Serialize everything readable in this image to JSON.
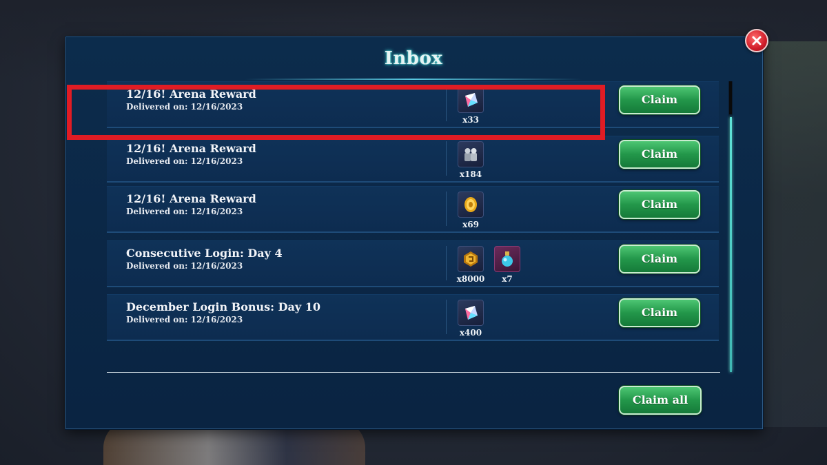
{
  "window": {
    "title": "Inbox"
  },
  "colors": {
    "accent": "#3fd3d0",
    "claim_button": "#23974a",
    "highlight": "#e01c24",
    "close_button": "#d11e2a"
  },
  "close_icon": "close-icon",
  "mails": [
    {
      "title": "12/16! Arena Reward",
      "date": "Delivered on: 12/16/2023",
      "rewards": [
        {
          "icon": "crystal-icon",
          "count": "x33"
        }
      ],
      "claim_label": "Claim"
    },
    {
      "title": "12/16! Arena Reward",
      "date": "Delivered on: 12/16/2023",
      "rewards": [
        {
          "icon": "armor-pieces-icon",
          "count": "x184"
        }
      ],
      "claim_label": "Claim"
    },
    {
      "title": "12/16! Arena Reward",
      "date": "Delivered on: 12/16/2023",
      "rewards": [
        {
          "icon": "gold-coin-icon",
          "count": "x69"
        }
      ],
      "claim_label": "Claim"
    },
    {
      "title": "Consecutive Login: Day 4",
      "date": "Delivered on: 12/16/2023",
      "rewards": [
        {
          "icon": "gold-emblem-icon",
          "count": "x8000"
        },
        {
          "icon": "potion-icon",
          "count": "x7"
        }
      ],
      "claim_label": "Claim"
    },
    {
      "title": "December Login Bonus: Day 10",
      "date": "Delivered on: 12/16/2023",
      "rewards": [
        {
          "icon": "crystal-icon",
          "count": "x400"
        }
      ],
      "claim_label": "Claim"
    }
  ],
  "footer": {
    "claim_all_label": "Claim all"
  }
}
